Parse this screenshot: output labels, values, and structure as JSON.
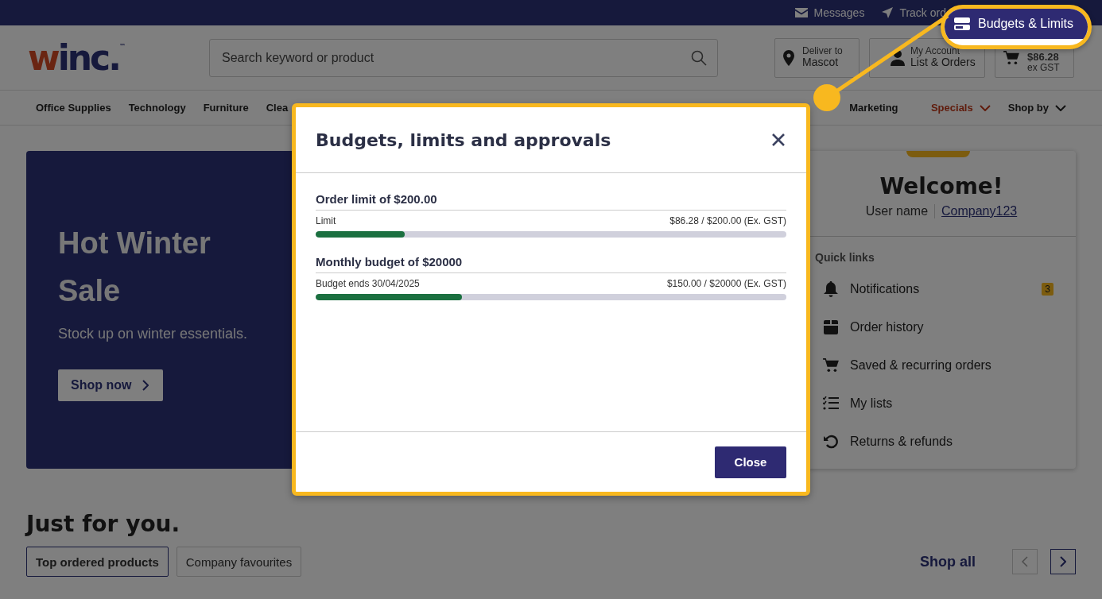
{
  "top_bar": {
    "links": [
      {
        "label": "Messages"
      },
      {
        "label": "Track ord"
      }
    ]
  },
  "logo": {
    "accent": "w",
    "rest": "inc.",
    "mark": "™"
  },
  "search": {
    "placeholder": "Search keyword or product"
  },
  "header_boxes": [
    {
      "small": "Deliver to",
      "large": "Mascot"
    },
    {
      "small": "My Account",
      "large": "List & Orders"
    },
    {
      "small": "$86.28",
      "large": "ex GST"
    }
  ],
  "nav": [
    {
      "label": "Office Supplies",
      "highlight": false,
      "caret": false
    },
    {
      "label": "Technology",
      "highlight": false,
      "caret": false
    },
    {
      "label": "Furniture",
      "highlight": false,
      "caret": false
    },
    {
      "label": "Clea",
      "highlight": false,
      "caret": false
    },
    {
      "label": "Marketing",
      "highlight": false,
      "caret": false
    },
    {
      "label": "Specials",
      "highlight": true,
      "caret": true
    },
    {
      "label": "Shop by",
      "highlight": false,
      "caret": true
    }
  ],
  "hero": {
    "title": "Hot Winter Sale",
    "subtitle": "Stock up on winter essentials.",
    "button": "Shop now"
  },
  "welcome": {
    "title": "Welcome!",
    "user_label": "User name",
    "user_link": "Company123",
    "quick_links_title": "Quick links",
    "quick_links": [
      {
        "label": "Notifications",
        "badge": "3"
      },
      {
        "label": "Order history"
      },
      {
        "label": "Saved & recurring orders"
      },
      {
        "label": "My lists"
      },
      {
        "label": "Returns & refunds"
      }
    ]
  },
  "section": {
    "title": "Just for you.",
    "tabs": [
      {
        "label": "Top ordered products",
        "selected": true
      },
      {
        "label": "Company favourites",
        "selected": false
      }
    ],
    "shop_all": "Shop all",
    "pager": [
      {
        "kind": "prev",
        "disabled": true
      },
      {
        "kind": "next",
        "disabled": false
      }
    ]
  },
  "callout": {
    "button": "Budgets & Limits"
  },
  "modal": {
    "title": "Budgets, limits and approvals",
    "sections": [
      {
        "title": "Order limit of $200.00",
        "label": "Limit",
        "reading": "$86.28 / $200.00 (Ex. GST)",
        "level": 0.19
      },
      {
        "title": "Monthly budget of $20000",
        "label": "Budget ends 30/04/2025",
        "reading": "$150.00 / $20000 (Ex. GST)",
        "level": 0.31
      }
    ],
    "close_button": "Close"
  }
}
